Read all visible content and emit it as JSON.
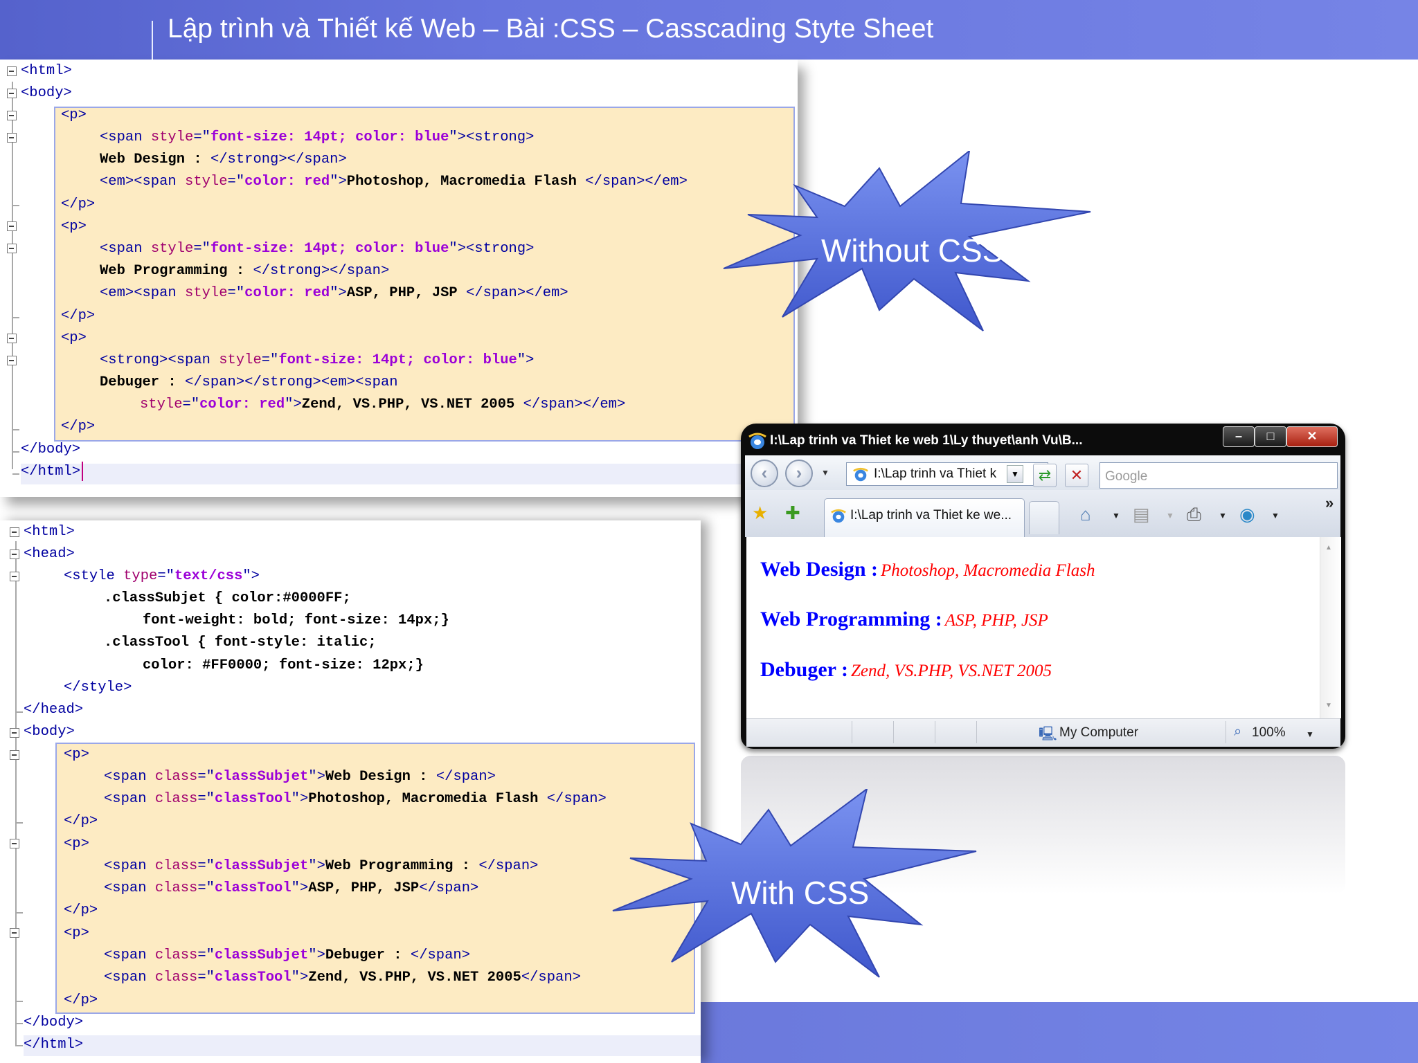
{
  "header": {
    "title": "Lập trình và Thiết kế Web  – Bài  :CSS – Casscading Styte Sheet"
  },
  "callouts": {
    "without_css": "Without CSS",
    "with_css": "With CSS"
  },
  "colors": {
    "header": "#6775de",
    "highlight": "#fdebc3",
    "star": "#4e6ad8",
    "subject": "#0000ff",
    "tool": "#ff0000"
  },
  "code_without_css": {
    "l1": "<html>",
    "l2": "<body>",
    "l3": "<p>",
    "l4": {
      "t1": "<span ",
      "a1": "style",
      "eq": "=\"",
      "v1": "font-size: 14pt; color: blue",
      "t2": "\"><strong>"
    },
    "l5": {
      "b": "Web Design : ",
      "t": "</strong></span>"
    },
    "l6": {
      "t1": "<em><span ",
      "a1": "style",
      "eq": "=\"",
      "v1": "color: red",
      "t2": "\">",
      "b": "Photoshop, Macromedia Flash ",
      "t3": "</span></em>"
    },
    "l7": "</p>",
    "l8": "<p>",
    "l9": {
      "t1": "<span ",
      "a1": "style",
      "eq": "=\"",
      "v1": "font-size: 14pt; color: blue",
      "t2": "\"><strong>"
    },
    "l10": {
      "b": "Web Programming : ",
      "t": "</strong></span>"
    },
    "l11": {
      "t1": "<em><span ",
      "a1": "style",
      "eq": "=\"",
      "v1": "color: red",
      "t2": "\">",
      "b": "ASP, PHP, JSP ",
      "t3": "</span></em>"
    },
    "l12": "</p>",
    "l13": "<p>",
    "l14": {
      "t1": "<strong><span ",
      "a1": "style",
      "eq": "=\"",
      "v1": "font-size: 14pt; color: blue",
      "t2": "\">"
    },
    "l15": {
      "b": "Debuger : ",
      "t": "</span></strong><em><span"
    },
    "l16": {
      "a1": "style",
      "eq": "=\"",
      "v1": "color: red",
      "t2": "\">",
      "b": "Zend, VS.PHP, VS.NET 2005 ",
      "t3": "</span></em>"
    },
    "l17": "</p>",
    "l18": "</body>",
    "l19": "</html>"
  },
  "code_with_css": {
    "l1": "<html>",
    "l2": "<head>",
    "l3": {
      "t1": "<style ",
      "a1": "type",
      "eq": "=\"",
      "v1": "text/css",
      "t2": "\">"
    },
    "l4": ".classSubjet { color:#0000FF;",
    "l5": "font-weight: bold; font-size: 14px;}",
    "l6": ".classTool { font-style: italic;",
    "l7": "color: #FF0000; font-size: 12px;}",
    "l8": "</style>",
    "l9": "</head>",
    "l10": "<body>",
    "l11": "<p>",
    "l12": {
      "t1": "<span ",
      "a1": "class",
      "eq": "=\"",
      "v1": "classSubjet",
      "t2": "\">",
      "b": "Web Design : ",
      "t3": "</span>"
    },
    "l13": {
      "t1": "<span ",
      "a1": "class",
      "eq": "=\"",
      "v1": "classTool",
      "t2": "\">",
      "b": "Photoshop, Macromedia Flash ",
      "t3": "</span>"
    },
    "l14": "</p>",
    "l15": "<p>",
    "l16": {
      "t1": "<span ",
      "a1": "class",
      "eq": "=\"",
      "v1": "classSubjet",
      "t2": "\">",
      "b": "Web Programming : ",
      "t3": "</span>"
    },
    "l17": {
      "t1": "<span ",
      "a1": "class",
      "eq": "=\"",
      "v1": "classTool",
      "t2": "\">",
      "b": "ASP, PHP, JSP",
      "t3": "</span>"
    },
    "l18": "</p>",
    "l19": "<p>",
    "l20": {
      "t1": "<span ",
      "a1": "class",
      "eq": "=\"",
      "v1": "classSubjet",
      "t2": "\">",
      "b": "Debuger : ",
      "t3": "</span>"
    },
    "l21": {
      "t1": "<span ",
      "a1": "class",
      "eq": "=\"",
      "v1": "classTool",
      "t2": "\">",
      "b": "Zend, VS.PHP, VS.NET 2005",
      "t3": "</span>"
    },
    "l22": "</p>",
    "l23": "</body>",
    "l24": "</html>"
  },
  "browser": {
    "title": "I:\\Lap trinh va Thiet ke web 1\\Ly thuyet\\anh Vu\\B...",
    "window_buttons": {
      "minimize": "–",
      "maximize": "□",
      "close": "✕"
    },
    "address": "I:\\Lap trinh va Thiet k",
    "search_placeholder": "Google",
    "tab_label": "I:\\Lap trinh va Thiet ke we...",
    "overflow": "»",
    "content": [
      {
        "subject": "Web Design :",
        "tool": "Photoshop, Macromedia Flash"
      },
      {
        "subject": "Web Programming :",
        "tool": "ASP, PHP, JSP"
      },
      {
        "subject": "Debuger :",
        "tool": "Zend, VS.PHP, VS.NET 2005"
      }
    ],
    "status_zone": "My Computer",
    "zoom": "100%"
  }
}
